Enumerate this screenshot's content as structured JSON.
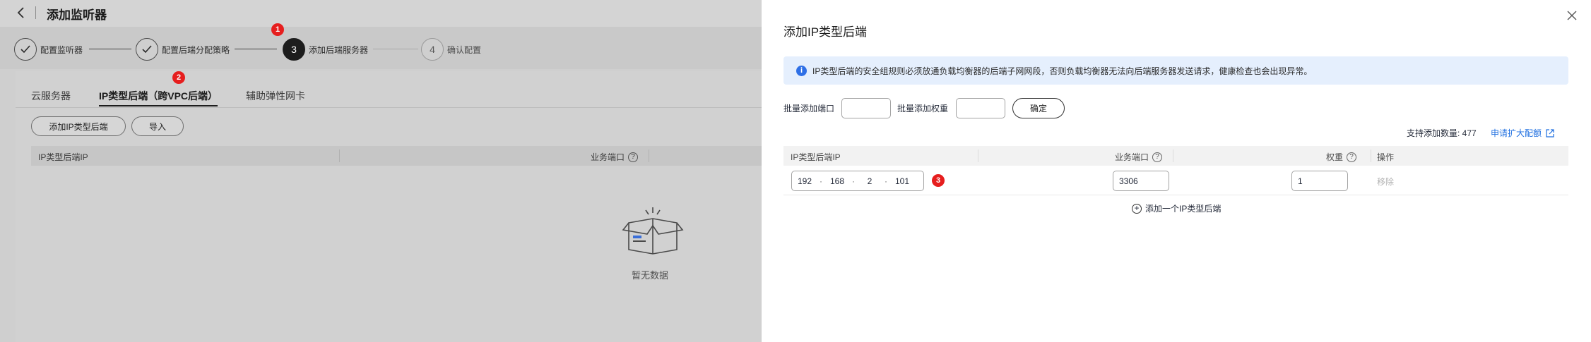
{
  "page": {
    "title": "添加监听器",
    "steps": [
      {
        "number": "",
        "label": "配置监听器",
        "state": "done"
      },
      {
        "number": "",
        "label": "配置后端分配策略",
        "state": "done"
      },
      {
        "number": "3",
        "label": "添加后端服务器",
        "state": "active"
      },
      {
        "number": "4",
        "label": "确认配置",
        "state": "todo"
      }
    ],
    "tabs": [
      "云服务器",
      "IP类型后端（跨VPC后端）",
      "辅助弹性网卡"
    ],
    "buttons": {
      "add_ip_backend": "添加IP类型后端",
      "import": "导入"
    },
    "table_headers": {
      "ip": "IP类型后端IP",
      "port": "业务端口"
    },
    "empty_text": "暂无数据"
  },
  "callouts": [
    "1",
    "2",
    "3"
  ],
  "drawer": {
    "title": "添加IP类型后端",
    "info": "IP类型后端的安全组规则必须放通负载均衡器的后端子网网段，否则负载均衡器无法向后端服务器发送请求，健康检查也会出现异常。",
    "batch_port_label": "批量添加端口",
    "batch_weight_label": "批量添加权重",
    "confirm": "确定",
    "quota": "支持添加数量: 477",
    "quota_link": "申请扩大配额",
    "headers": {
      "ip": "IP类型后端IP",
      "port": "业务端口",
      "weight": "权重",
      "action": "操作"
    },
    "row": {
      "ip": [
        "192",
        "168",
        "2",
        "101"
      ],
      "port": "3306",
      "weight": "1",
      "remove": "移除"
    },
    "add_row": "添加一个IP类型后端"
  },
  "colors": {
    "accent": "#1f6fe0",
    "badge": "#e61e1e",
    "info_bg": "#e5effd"
  },
  "icons": [
    "back-arrow-icon",
    "check-icon",
    "close-icon",
    "info-icon",
    "help-icon",
    "external-link-icon",
    "plus-circle-icon",
    "empty-box-icon"
  ]
}
